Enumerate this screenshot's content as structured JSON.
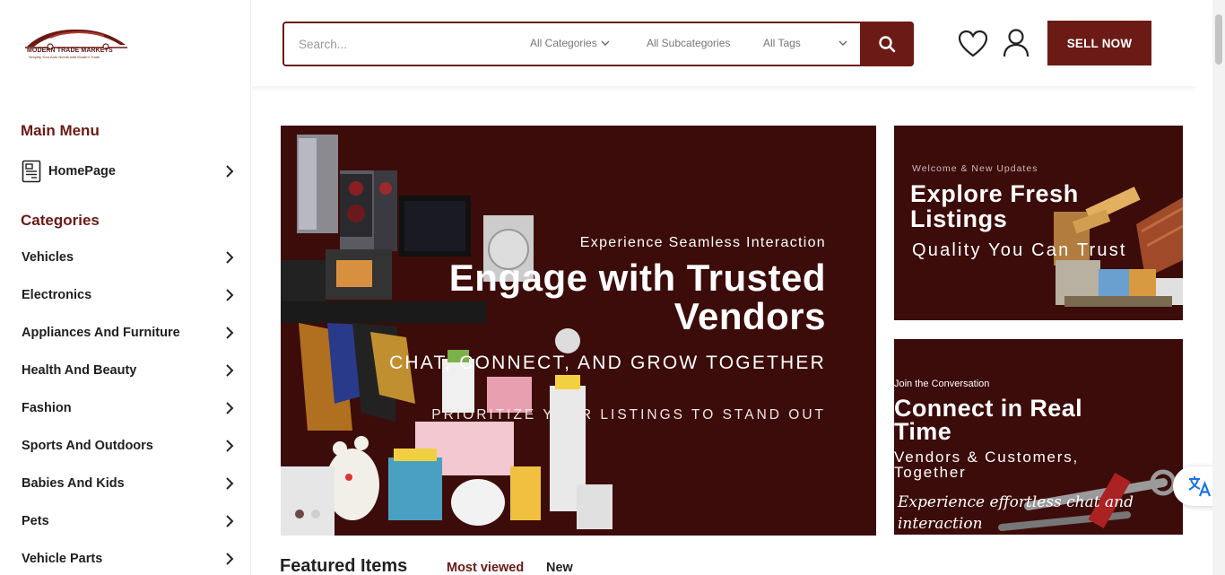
{
  "logo": {
    "name": "MODERN TRADE MARKETS",
    "tagline": "Simplify Your Auto Needs with Modern Trade"
  },
  "sidebar": {
    "main_menu_heading": "Main Menu",
    "home_item": {
      "label": "HomePage",
      "icon": "document-icon"
    },
    "categories_heading": "Categories",
    "categories": [
      {
        "label": "Vehicles"
      },
      {
        "label": "Electronics"
      },
      {
        "label": "Appliances And Furniture"
      },
      {
        "label": "Health And Beauty"
      },
      {
        "label": "Fashion"
      },
      {
        "label": "Sports And Outdoors"
      },
      {
        "label": "Babies And Kids"
      },
      {
        "label": "Pets"
      },
      {
        "label": "Vehicle Parts"
      }
    ]
  },
  "search": {
    "placeholder": "Search...",
    "category_select": "All Categories",
    "subcategory_select": "All Subcategories",
    "tags_select": "All Tags",
    "button_icon": "search-icon"
  },
  "header": {
    "wishlist_icon": "heart-icon",
    "account_icon": "user-icon",
    "sell_label": "SELL NOW"
  },
  "hero": {
    "eyebrow": "Experience Seamless Interaction",
    "title_line1": "Engage with Trusted",
    "title_line2": "Vendors",
    "subtitle": "CHAT, CONNECT, AND GROW TOGETHER",
    "subtitle2": "PRIORITIZE YOUR LISTINGS TO STAND OUT"
  },
  "banner1": {
    "eyebrow": "Welcome & New Updates",
    "title_line1": "Explore Fresh",
    "title_line2": "Listings",
    "subtitle": "Quality You Can Trust"
  },
  "banner2": {
    "eyebrow": "Join the Conversation",
    "title_line1": "Connect in Real",
    "title_line2": "Time",
    "subtitle_line1": "Vendors & Customers,",
    "subtitle_line2": "Together",
    "script_line1": "Experience effortless chat and",
    "script_line2": "interaction"
  },
  "featured": {
    "heading": "Featured Items",
    "tabs": [
      {
        "label": "Most viewed",
        "active": true
      },
      {
        "label": "New",
        "active": false
      }
    ]
  },
  "colors": {
    "brand": "#6b1a15",
    "banner_bg": "#3c0c0a"
  },
  "translate_icon": "translate-icon"
}
